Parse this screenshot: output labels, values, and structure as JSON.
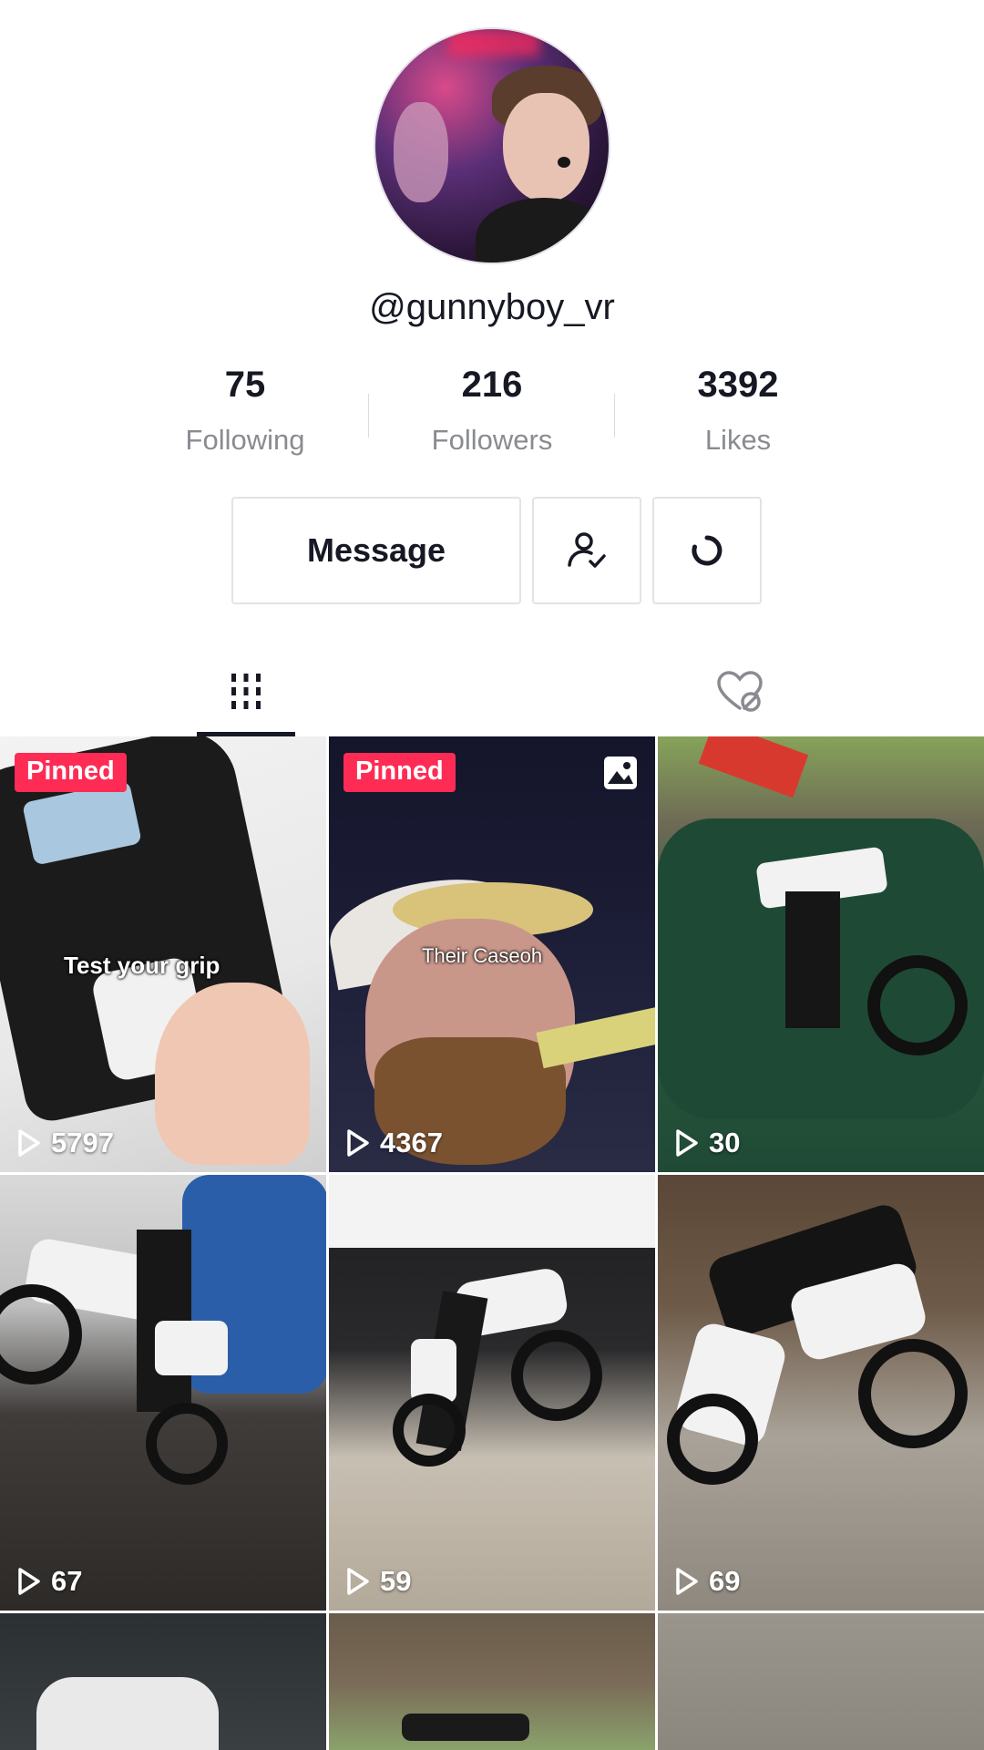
{
  "profile": {
    "username": "@gunnyboy_vr"
  },
  "stats": [
    {
      "value": "75",
      "label": "Following"
    },
    {
      "value": "216",
      "label": "Followers"
    },
    {
      "value": "3392",
      "label": "Likes"
    }
  ],
  "actions": {
    "message_label": "Message",
    "follow_icon": "person-check-icon",
    "more_icon": "refresh-icon"
  },
  "tabs": {
    "videos_icon": "grid-icon",
    "liked_icon": "hidden-heart-icon",
    "active": "videos"
  },
  "grid": [
    {
      "pinned": true,
      "pinned_label": "Pinned",
      "views": "5797",
      "caption": "Test your grip",
      "badge": "none"
    },
    {
      "pinned": true,
      "pinned_label": "Pinned",
      "views": "4367",
      "caption": "Their Caseoh",
      "badge": "photo-icon"
    },
    {
      "pinned": false,
      "views": "30"
    },
    {
      "pinned": false,
      "views": "67"
    },
    {
      "pinned": false,
      "views": "59"
    },
    {
      "pinned": false,
      "views": "69"
    },
    {
      "pinned": false,
      "views": ""
    },
    {
      "pinned": false,
      "views": ""
    },
    {
      "pinned": false,
      "views": ""
    }
  ],
  "colors": {
    "accent": "#fe2c55",
    "text": "#161823",
    "muted": "#8a8b91"
  }
}
